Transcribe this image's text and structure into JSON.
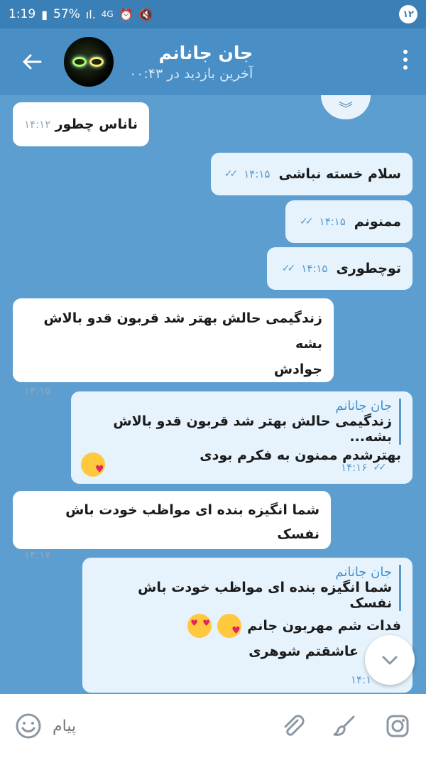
{
  "status": {
    "time": "1:19",
    "battery": "57%",
    "network": "4G",
    "notif_count": "۱۲"
  },
  "header": {
    "title": "جان جانانم",
    "subtitle": "آخرین بازدید در ۰۰:۴۳"
  },
  "messages": [
    {
      "dir": "in",
      "text": "ناناس چطور",
      "time": "۱۴:۱۲"
    },
    {
      "dir": "out",
      "text": "سلام خسته نباشی",
      "time": "۱۴:۱۵"
    },
    {
      "dir": "out",
      "text": "ممنونم",
      "time": "۱۴:۱۵"
    },
    {
      "dir": "out",
      "text": "توچطوری",
      "time": "۱۴:۱۵"
    },
    {
      "dir": "in",
      "text1": "زندگیمی حالش بهتر شد قربون قدو بالاش بشه",
      "text2": "جوادش",
      "time": "۱۴:۱۵"
    },
    {
      "dir": "out",
      "reply_name": "جان جانانم",
      "reply_text": "زندگیمی حالش بهتر شد قربون قدو بالاش بشه...",
      "text": "بهترشدم ممنون به فکرم بودی",
      "time": "۱۴:۱۶"
    },
    {
      "dir": "in",
      "text": "شما انگیزه بنده ای مواظب خودت باش نفسک",
      "time": "۱۴:۱۷"
    },
    {
      "dir": "out",
      "reply_name": "جان جانانم",
      "reply_text": "شما انگیزه بنده ای مواظب خودت باش نفسک",
      "text1": "فدات شم مهربون جانم",
      "text2": "عاشقتم شوهری",
      "time": "۱۴:۱"
    }
  ],
  "input": {
    "placeholder": "پیام"
  },
  "icons": {
    "back": "arrow-left-icon",
    "menu": "more-vert-icon",
    "scroll": "chevron-down-icon",
    "emoji": "emoji-icon",
    "attach": "paperclip-icon",
    "draw": "brush-icon",
    "camera": "instagram-icon"
  }
}
